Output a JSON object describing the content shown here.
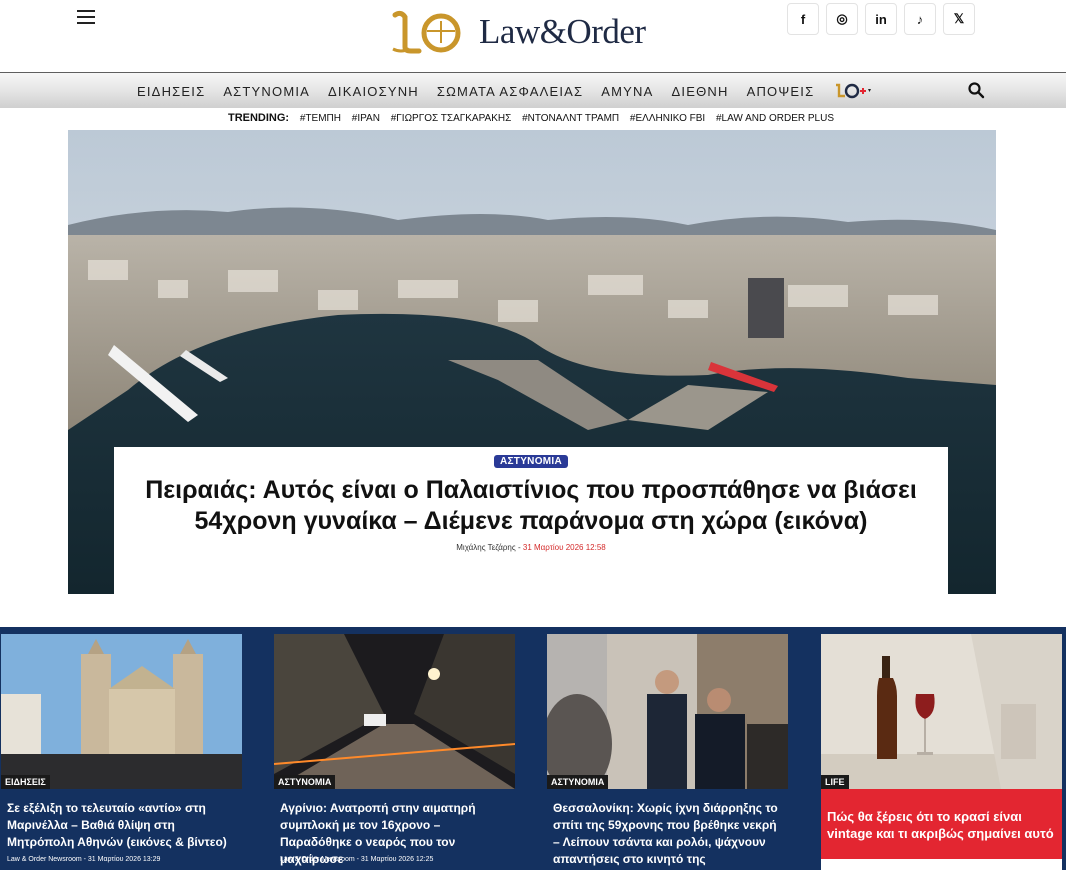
{
  "header": {
    "logo_text": "Law&Order",
    "logo_mark": "LO",
    "socials": [
      {
        "name": "facebook-icon",
        "glyph": "f"
      },
      {
        "name": "instagram-icon",
        "glyph": "◎"
      },
      {
        "name": "linkedin-icon",
        "glyph": "in"
      },
      {
        "name": "tiktok-icon",
        "glyph": "♪"
      },
      {
        "name": "x-icon",
        "glyph": "𝕏"
      }
    ]
  },
  "nav": {
    "items": [
      "ΕΙΔΗΣΕΙΣ",
      "ΑΣΤΥΝΟΜΙΑ",
      "ΔΙΚΑΙΟΣΥΝΗ",
      "ΣΩΜΑΤΑ ΑΣΦΑΛΕΙΑΣ",
      "ΑΜΥΝΑ",
      "ΔΙΕΘΝΗ",
      "ΑΠΟΨΕΙΣ"
    ],
    "plus_label": "LO+"
  },
  "trending": {
    "label": "TRENDING:",
    "links": [
      "#ΤΕΜΠΗ",
      "#ΙΡΑΝ",
      "#ΓΙΩΡΓΟΣ ΤΣΑΓΚΑΡΑΚΗΣ",
      "#ΝΤΟΝΑΛΝΤ ΤΡΑΜΠ",
      "#ΕΛΛΗΝΙΚΟ FBI",
      "#LAW AND ORDER PLUS"
    ]
  },
  "hero": {
    "category": "ΑΣΤΥΝΟΜΙΑ",
    "title": "Πειραιάς: Αυτός είναι ο Παλαιστίνιος που προσπάθησε να βιάσει 54χρονη γυναίκα – Διέμενε παράνομα στη χώρα (εικόνα)",
    "author": "Μιχάλης Τεζάρης",
    "separator": "-",
    "date": "31 Μαρτίου 2026 12:58"
  },
  "cards": [
    {
      "category": "ΕΙΔΗΣΕΙΣ",
      "title": "Σε εξέλιξη το τελευταίο «αντίο» στη Μαρινέλλα – Βαθιά θλίψη στη Μητρόπολη Αθηνών (εικόνες & βίντεο)",
      "meta": "Law & Order Newsroom - 31 Μαρτίου 2026 13:29"
    },
    {
      "category": "ΑΣΤΥΝΟΜΙΑ",
      "title": "Αγρίνιο: Ανατροπή στην αιματηρή συμπλοκή με τον 16χρονο – Παραδόθηκε ο νεαρός που τον μαχαίρωσε",
      "meta": "Law & Order Newsroom - 31 Μαρτίου 2026 12:25"
    },
    {
      "category": "ΑΣΤΥΝΟΜΙΑ",
      "title": "Θεσσαλονίκη: Χωρίς ίχνη διάρρηξης το σπίτι της 59χρονης που βρέθηκε νεκρή – Λείπουν τσάντα και ρολόι, ψάχνουν απαντήσεις στο κινητό της",
      "meta": ""
    },
    {
      "category": "LIFE",
      "title": "Πώς θα ξέρεις ότι το κρασί είναι vintage και τι ακριβώς σημαίνει αυτό",
      "meta": ""
    }
  ],
  "colors": {
    "brand_navy": "#1f2a44",
    "logo_gold": "#c9962b",
    "strip_bg": "#143160",
    "badge_blue": "#2a3a97",
    "life_red": "#e32631",
    "date_red": "#d42b2b"
  }
}
